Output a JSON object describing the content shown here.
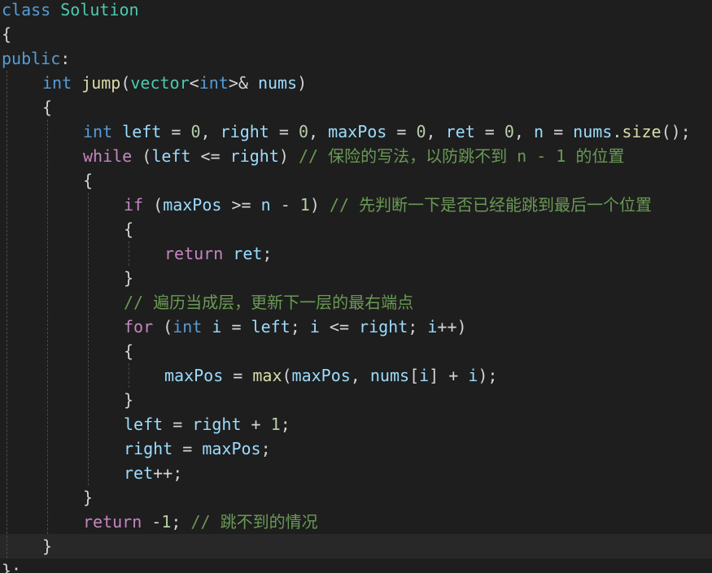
{
  "colors": {
    "background": "#1e1e1e",
    "current_line": "#282828",
    "keyword_blue": "#569cd6",
    "keyword_control": "#c586c0",
    "type": "#4ec9b0",
    "function": "#dcdcaa",
    "variable": "#9cdcfe",
    "number": "#b5cea8",
    "comment": "#6a9955",
    "default": "#d4d4d4",
    "guide": "#4a4a4a"
  },
  "lines": [
    {
      "indent": 0,
      "tokens": [
        {
          "t": "class",
          "c": "keyword_blue"
        },
        {
          "t": " ",
          "c": "default"
        },
        {
          "t": "Solution",
          "c": "type"
        }
      ]
    },
    {
      "indent": 0,
      "tokens": [
        {
          "t": "{",
          "c": "default"
        }
      ]
    },
    {
      "indent": 0,
      "tokens": [
        {
          "t": "public",
          "c": "keyword_blue"
        },
        {
          "t": ":",
          "c": "default"
        }
      ]
    },
    {
      "indent": 1,
      "tokens": [
        {
          "t": "int",
          "c": "keyword_blue"
        },
        {
          "t": " ",
          "c": "default"
        },
        {
          "t": "jump",
          "c": "function"
        },
        {
          "t": "(",
          "c": "default"
        },
        {
          "t": "vector",
          "c": "type"
        },
        {
          "t": "<",
          "c": "default"
        },
        {
          "t": "int",
          "c": "keyword_blue"
        },
        {
          "t": ">& ",
          "c": "default"
        },
        {
          "t": "nums",
          "c": "variable"
        },
        {
          "t": ")",
          "c": "default"
        }
      ]
    },
    {
      "indent": 1,
      "tokens": [
        {
          "t": "{",
          "c": "default"
        }
      ]
    },
    {
      "indent": 2,
      "tokens": [
        {
          "t": "int",
          "c": "keyword_blue"
        },
        {
          "t": " ",
          "c": "default"
        },
        {
          "t": "left",
          "c": "variable"
        },
        {
          "t": " = ",
          "c": "default"
        },
        {
          "t": "0",
          "c": "number"
        },
        {
          "t": ", ",
          "c": "default"
        },
        {
          "t": "right",
          "c": "variable"
        },
        {
          "t": " = ",
          "c": "default"
        },
        {
          "t": "0",
          "c": "number"
        },
        {
          "t": ", ",
          "c": "default"
        },
        {
          "t": "maxPos",
          "c": "variable"
        },
        {
          "t": " = ",
          "c": "default"
        },
        {
          "t": "0",
          "c": "number"
        },
        {
          "t": ", ",
          "c": "default"
        },
        {
          "t": "ret",
          "c": "variable"
        },
        {
          "t": " = ",
          "c": "default"
        },
        {
          "t": "0",
          "c": "number"
        },
        {
          "t": ", ",
          "c": "default"
        },
        {
          "t": "n",
          "c": "variable"
        },
        {
          "t": " = ",
          "c": "default"
        },
        {
          "t": "nums",
          "c": "variable"
        },
        {
          "t": ".",
          "c": "default"
        },
        {
          "t": "size",
          "c": "function"
        },
        {
          "t": "();",
          "c": "default"
        }
      ]
    },
    {
      "indent": 2,
      "tokens": [
        {
          "t": "while",
          "c": "keyword_control"
        },
        {
          "t": " (",
          "c": "default"
        },
        {
          "t": "left",
          "c": "variable"
        },
        {
          "t": " <= ",
          "c": "default"
        },
        {
          "t": "right",
          "c": "variable"
        },
        {
          "t": ") ",
          "c": "default"
        },
        {
          "t": "// 保险的写法，以防跳不到 n - 1 的位置",
          "c": "comment"
        }
      ]
    },
    {
      "indent": 2,
      "tokens": [
        {
          "t": "{",
          "c": "default"
        }
      ]
    },
    {
      "indent": 3,
      "tokens": [
        {
          "t": "if",
          "c": "keyword_control"
        },
        {
          "t": " (",
          "c": "default"
        },
        {
          "t": "maxPos",
          "c": "variable"
        },
        {
          "t": " >= ",
          "c": "default"
        },
        {
          "t": "n",
          "c": "variable"
        },
        {
          "t": " - ",
          "c": "default"
        },
        {
          "t": "1",
          "c": "number"
        },
        {
          "t": ") ",
          "c": "default"
        },
        {
          "t": "// 先判断一下是否已经能跳到最后一个位置",
          "c": "comment"
        }
      ]
    },
    {
      "indent": 3,
      "tokens": [
        {
          "t": "{",
          "c": "default"
        }
      ]
    },
    {
      "indent": 4,
      "tokens": [
        {
          "t": "return",
          "c": "keyword_control"
        },
        {
          "t": " ",
          "c": "default"
        },
        {
          "t": "ret",
          "c": "variable"
        },
        {
          "t": ";",
          "c": "default"
        }
      ]
    },
    {
      "indent": 3,
      "tokens": [
        {
          "t": "}",
          "c": "default"
        }
      ]
    },
    {
      "indent": 3,
      "tokens": [
        {
          "t": "// 遍历当成层，更新下一层的最右端点",
          "c": "comment"
        }
      ]
    },
    {
      "indent": 3,
      "tokens": [
        {
          "t": "for",
          "c": "keyword_control"
        },
        {
          "t": " (",
          "c": "default"
        },
        {
          "t": "int",
          "c": "keyword_blue"
        },
        {
          "t": " ",
          "c": "default"
        },
        {
          "t": "i",
          "c": "variable"
        },
        {
          "t": " = ",
          "c": "default"
        },
        {
          "t": "left",
          "c": "variable"
        },
        {
          "t": "; ",
          "c": "default"
        },
        {
          "t": "i",
          "c": "variable"
        },
        {
          "t": " <= ",
          "c": "default"
        },
        {
          "t": "right",
          "c": "variable"
        },
        {
          "t": "; ",
          "c": "default"
        },
        {
          "t": "i",
          "c": "variable"
        },
        {
          "t": "++)",
          "c": "default"
        }
      ]
    },
    {
      "indent": 3,
      "tokens": [
        {
          "t": "{",
          "c": "default"
        }
      ]
    },
    {
      "indent": 4,
      "tokens": [
        {
          "t": "maxPos",
          "c": "variable"
        },
        {
          "t": " = ",
          "c": "default"
        },
        {
          "t": "max",
          "c": "function"
        },
        {
          "t": "(",
          "c": "default"
        },
        {
          "t": "maxPos",
          "c": "variable"
        },
        {
          "t": ", ",
          "c": "default"
        },
        {
          "t": "nums",
          "c": "variable"
        },
        {
          "t": "[",
          "c": "default"
        },
        {
          "t": "i",
          "c": "variable"
        },
        {
          "t": "] + ",
          "c": "default"
        },
        {
          "t": "i",
          "c": "variable"
        },
        {
          "t": ");",
          "c": "default"
        }
      ]
    },
    {
      "indent": 3,
      "tokens": [
        {
          "t": "}",
          "c": "default"
        }
      ]
    },
    {
      "indent": 3,
      "tokens": [
        {
          "t": "left",
          "c": "variable"
        },
        {
          "t": " = ",
          "c": "default"
        },
        {
          "t": "right",
          "c": "variable"
        },
        {
          "t": " + ",
          "c": "default"
        },
        {
          "t": "1",
          "c": "number"
        },
        {
          "t": ";",
          "c": "default"
        }
      ]
    },
    {
      "indent": 3,
      "tokens": [
        {
          "t": "right",
          "c": "variable"
        },
        {
          "t": " = ",
          "c": "default"
        },
        {
          "t": "maxPos",
          "c": "variable"
        },
        {
          "t": ";",
          "c": "default"
        }
      ]
    },
    {
      "indent": 3,
      "tokens": [
        {
          "t": "ret",
          "c": "variable"
        },
        {
          "t": "++;",
          "c": "default"
        }
      ]
    },
    {
      "indent": 2,
      "tokens": [
        {
          "t": "}",
          "c": "default"
        }
      ]
    },
    {
      "indent": 2,
      "tokens": [
        {
          "t": "return",
          "c": "keyword_control"
        },
        {
          "t": " -",
          "c": "default"
        },
        {
          "t": "1",
          "c": "number"
        },
        {
          "t": "; ",
          "c": "default"
        },
        {
          "t": "// 跳不到的情况",
          "c": "comment"
        }
      ]
    },
    {
      "indent": 1,
      "tokens": [
        {
          "t": "}",
          "c": "default"
        }
      ],
      "current": true
    },
    {
      "indent": 0,
      "tokens": [
        {
          "t": "};",
          "c": "default"
        }
      ]
    }
  ]
}
